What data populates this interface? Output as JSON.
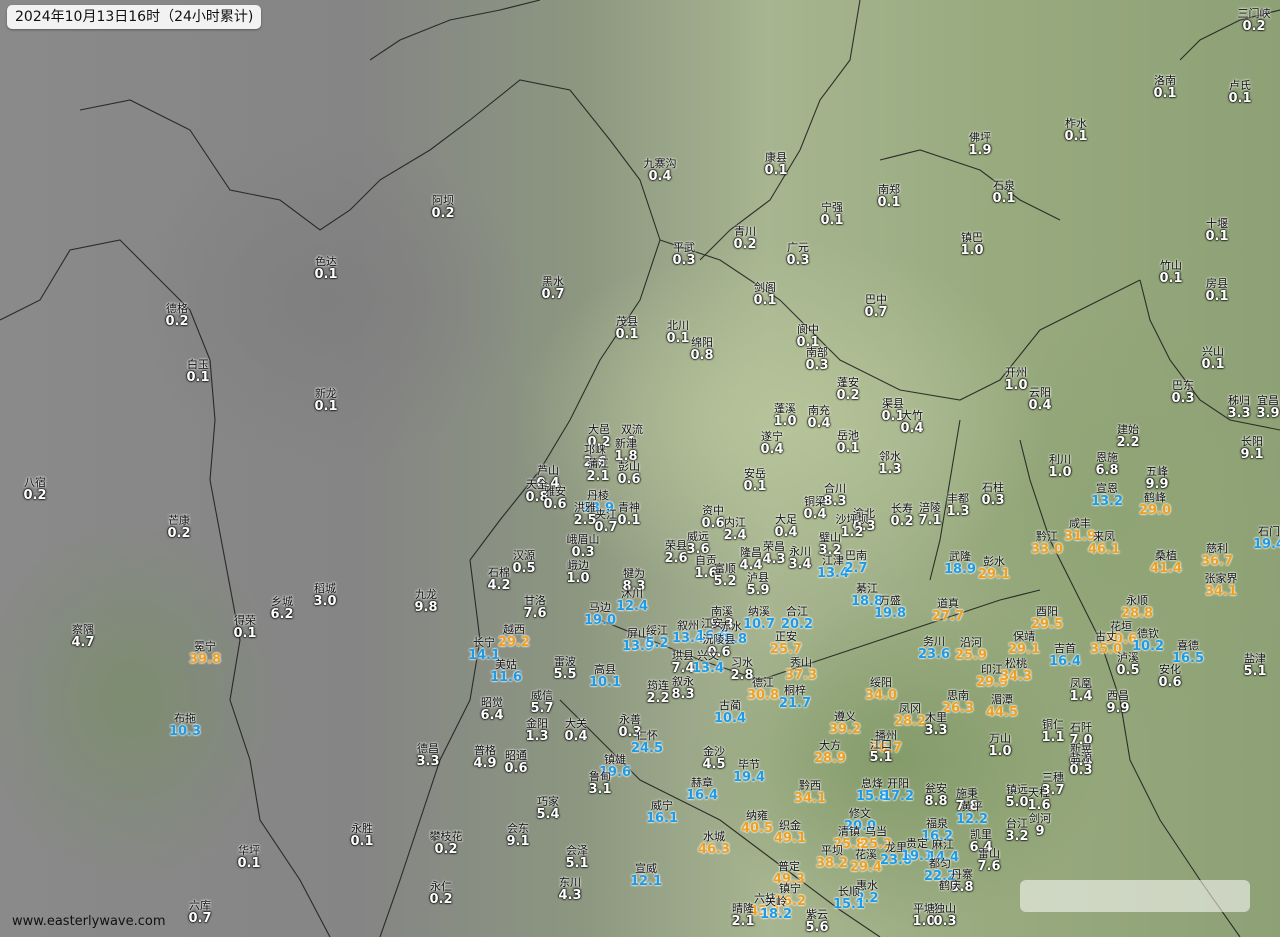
{
  "header": {
    "title": "2024年10月13日16时（24小时累计)"
  },
  "footer": {
    "credit": "www.easterlywave.com"
  },
  "legend_colors": {
    "low": "#ffffff",
    "moderate": "#1e9be6",
    "heavy": "#f0a020"
  },
  "stations": [
    {
      "name": "三门峡",
      "value": "0.2",
      "cls": "w"
    },
    {
      "name": "洛南",
      "value": "0.1",
      "cls": "w"
    },
    {
      "name": "卢氏",
      "value": "0.1",
      "cls": "w"
    },
    {
      "name": "柞水",
      "value": "0.1",
      "cls": "w"
    },
    {
      "name": "佛坪",
      "value": "1.9",
      "cls": "w"
    },
    {
      "name": "九寨沟",
      "value": "0.4",
      "cls": "w"
    },
    {
      "name": "康县",
      "value": "0.1",
      "cls": "w"
    },
    {
      "name": "南郑",
      "value": "0.1",
      "cls": "w"
    },
    {
      "name": "石泉",
      "value": "0.1",
      "cls": "w"
    },
    {
      "name": "阿坝",
      "value": "0.2",
      "cls": "w"
    },
    {
      "name": "宁强",
      "value": "0.1",
      "cls": "w"
    },
    {
      "name": "镇巴",
      "value": "1.0",
      "cls": "w"
    },
    {
      "name": "十堰",
      "value": "0.1",
      "cls": "w"
    },
    {
      "name": "青川",
      "value": "0.2",
      "cls": "w"
    },
    {
      "name": "平武",
      "value": "0.3",
      "cls": "w"
    },
    {
      "name": "广元",
      "value": "0.3",
      "cls": "w"
    },
    {
      "name": "色达",
      "value": "0.1",
      "cls": "w"
    },
    {
      "name": "黑水",
      "value": "0.7",
      "cls": "w"
    },
    {
      "name": "竹山",
      "value": "0.1",
      "cls": "w"
    },
    {
      "name": "房县",
      "value": "0.1",
      "cls": "w"
    },
    {
      "name": "剑阁",
      "value": "0.1",
      "cls": "w"
    },
    {
      "name": "巴中",
      "value": "0.7",
      "cls": "w"
    },
    {
      "name": "德格",
      "value": "0.2",
      "cls": "w"
    },
    {
      "name": "茂县",
      "value": "0.1",
      "cls": "w"
    },
    {
      "name": "北川",
      "value": "0.1",
      "cls": "w"
    },
    {
      "name": "阆中",
      "value": "0.1",
      "cls": "w"
    },
    {
      "name": "绵阳",
      "value": "0.8",
      "cls": "w"
    },
    {
      "name": "南部",
      "value": "0.3",
      "cls": "w"
    },
    {
      "name": "兴山",
      "value": "0.1",
      "cls": "w"
    },
    {
      "name": "白玉",
      "value": "0.1",
      "cls": "w"
    },
    {
      "name": "开州",
      "value": "1.0",
      "cls": "w"
    },
    {
      "name": "蓬安",
      "value": "0.2",
      "cls": "w"
    },
    {
      "name": "巴东",
      "value": "0.3",
      "cls": "w"
    },
    {
      "name": "新龙",
      "value": "0.1",
      "cls": "w"
    },
    {
      "name": "云阳",
      "value": "0.4",
      "cls": "w"
    },
    {
      "name": "秭归",
      "value": "3.3",
      "cls": "w"
    },
    {
      "name": "宜昌",
      "value": "3.9",
      "cls": "w"
    },
    {
      "name": "渠县",
      "value": "0.1",
      "cls": "w"
    },
    {
      "name": "大竹",
      "value": "0.4",
      "cls": "w"
    },
    {
      "name": "蓬溪",
      "value": "1.0",
      "cls": "w"
    },
    {
      "name": "南充",
      "value": "0.4",
      "cls": "w"
    },
    {
      "name": "大邑",
      "value": "0.2",
      "cls": "w"
    },
    {
      "name": "双流",
      "value": "1",
      "cls": "w"
    },
    {
      "name": "建始",
      "value": "2.2",
      "cls": "w"
    },
    {
      "name": "长阳",
      "value": "9.1",
      "cls": "w"
    },
    {
      "name": "新津",
      "value": "1.8",
      "cls": "w"
    },
    {
      "name": "遂宁",
      "value": "0.4",
      "cls": "w"
    },
    {
      "name": "岳池",
      "value": "0.1",
      "cls": "w"
    },
    {
      "name": "邛崃",
      "value": "2.6",
      "cls": "w"
    },
    {
      "name": "蒲江",
      "value": "2.1",
      "cls": "w"
    },
    {
      "name": "彭山",
      "value": "0.6",
      "cls": "w"
    },
    {
      "name": "邻水",
      "value": "1.3",
      "cls": "w"
    },
    {
      "name": "利川",
      "value": "1.0",
      "cls": "w"
    },
    {
      "name": "恩施",
      "value": "6.8",
      "cls": "w"
    },
    {
      "name": "五峰",
      "value": "9.9",
      "cls": "w"
    },
    {
      "name": "芦山",
      "value": "0.4",
      "cls": "w"
    },
    {
      "name": "安岳",
      "value": "0.1",
      "cls": "w"
    },
    {
      "name": "合川",
      "value": "8.3",
      "cls": "w"
    },
    {
      "name": "石柱",
      "value": "0.3",
      "cls": "w"
    },
    {
      "name": "八宿",
      "value": "0.2",
      "cls": "w"
    },
    {
      "name": "天全",
      "value": "0.8",
      "cls": "w"
    },
    {
      "name": "雅安",
      "value": "0.6",
      "cls": "w"
    },
    {
      "name": "丹棱",
      "value": "13.9",
      "cls": "blue"
    },
    {
      "name": "宣恩",
      "value": "13.2",
      "cls": "blue"
    },
    {
      "name": "鹤峰",
      "value": "29.0",
      "cls": "orange"
    },
    {
      "name": "洪雅",
      "value": "2.5",
      "cls": "w"
    },
    {
      "name": "夹江",
      "value": "0.7",
      "cls": "w"
    },
    {
      "name": "青神",
      "value": "0.1",
      "cls": "w"
    },
    {
      "name": "资中",
      "value": "0.6",
      "cls": "w"
    },
    {
      "name": "铜梁",
      "value": "0.4",
      "cls": "w"
    },
    {
      "name": "渝北",
      "value": "0.3",
      "cls": "w"
    },
    {
      "name": "长寿",
      "value": "0.2",
      "cls": "w"
    },
    {
      "name": "涪陵",
      "value": "7.1",
      "cls": "w"
    },
    {
      "name": "丰都",
      "value": "1.3",
      "cls": "w"
    },
    {
      "name": "芒康",
      "value": "0.2",
      "cls": "w"
    },
    {
      "name": "内江",
      "value": "2.4",
      "cls": "w"
    },
    {
      "name": "大足",
      "value": "0.4",
      "cls": "w"
    },
    {
      "name": "璧山",
      "value": "3.2",
      "cls": "w"
    },
    {
      "name": "沙坪坝",
      "value": "1.2",
      "cls": "w"
    },
    {
      "name": "黔江",
      "value": "33.0",
      "cls": "orange"
    },
    {
      "name": "咸丰",
      "value": "31.9",
      "cls": "orange"
    },
    {
      "name": "来凤",
      "value": "46.1",
      "cls": "orange"
    },
    {
      "name": "石门",
      "value": "19.4",
      "cls": "blue"
    },
    {
      "name": "峨眉山",
      "value": "0.3",
      "cls": "w"
    },
    {
      "name": "荣县",
      "value": "2.6",
      "cls": "w"
    },
    {
      "name": "威远",
      "value": "3.6",
      "cls": "w"
    },
    {
      "name": "自贡",
      "value": "1.6",
      "cls": "w"
    },
    {
      "name": "隆昌",
      "value": "4.4",
      "cls": "w"
    },
    {
      "name": "荣昌",
      "value": "4.3",
      "cls": "w"
    },
    {
      "name": "永川",
      "value": "3.4",
      "cls": "w"
    },
    {
      "name": "江津",
      "value": "13.4",
      "cls": "blue"
    },
    {
      "name": "巴南",
      "value": "2.7",
      "cls": "blue"
    },
    {
      "name": "武隆",
      "value": "18.9",
      "cls": "blue"
    },
    {
      "name": "彭水",
      "value": "29.1",
      "cls": "orange"
    },
    {
      "name": "桑植",
      "value": "41.4",
      "cls": "orange"
    },
    {
      "name": "慈利",
      "value": "36.7",
      "cls": "orange"
    },
    {
      "name": "汉源",
      "value": "0.5",
      "cls": "w"
    },
    {
      "name": "峨边",
      "value": "1.0",
      "cls": "w"
    },
    {
      "name": "富顺",
      "value": "5.2",
      "cls": "w"
    },
    {
      "name": "泸县",
      "value": "5.9",
      "cls": "w"
    },
    {
      "name": "张家界",
      "value": "34.1",
      "cls": "orange"
    },
    {
      "name": "稻城",
      "value": "3.0",
      "cls": "w"
    },
    {
      "name": "乡城",
      "value": "6.2",
      "cls": "w"
    },
    {
      "name": "九龙",
      "value": "9.8",
      "cls": "w"
    },
    {
      "name": "石棉",
      "value": "4.2",
      "cls": "w"
    },
    {
      "name": "甘洛",
      "value": "7.6",
      "cls": "w"
    },
    {
      "name": "犍为",
      "value": "8.3",
      "cls": "w"
    },
    {
      "name": "沐川",
      "value": "12.4",
      "cls": "blue"
    },
    {
      "name": "綦江",
      "value": "18.8",
      "cls": "blue"
    },
    {
      "name": "万盛",
      "value": "19.8",
      "cls": "blue"
    },
    {
      "name": "道真",
      "value": "27.7",
      "cls": "orange"
    },
    {
      "name": "酉阳",
      "value": "29.5",
      "cls": "orange"
    },
    {
      "name": "永顺",
      "value": "28.8",
      "cls": "orange"
    },
    {
      "name": "得荣",
      "value": "0.1",
      "cls": "w"
    },
    {
      "name": "马边",
      "value": "19.0",
      "cls": "blue"
    },
    {
      "name": "南溪",
      "value": "9.3",
      "cls": "w"
    },
    {
      "name": "纳溪",
      "value": "10.7",
      "cls": "blue"
    },
    {
      "name": "合江",
      "value": "20.2",
      "cls": "blue"
    },
    {
      "name": "察隅",
      "value": "4.7",
      "cls": "w"
    },
    {
      "name": "越西",
      "value": "29.2",
      "cls": "orange"
    },
    {
      "name": "屏山",
      "value": "13.9",
      "cls": "blue"
    },
    {
      "name": "绥江",
      "value": "5.2",
      "cls": "blue"
    },
    {
      "name": "叙州",
      "value": "13.4",
      "cls": "blue"
    },
    {
      "name": "江安",
      "value": "16.6",
      "cls": "blue"
    },
    {
      "name": "赤水",
      "value": "18.8",
      "cls": "blue"
    },
    {
      "name": "正安",
      "value": "25.7",
      "cls": "orange"
    },
    {
      "name": "务川",
      "value": "23.6",
      "cls": "blue"
    },
    {
      "name": "沿河",
      "value": "25.9",
      "cls": "orange"
    },
    {
      "name": "保靖",
      "value": "29.1",
      "cls": "orange"
    },
    {
      "name": "花垣",
      "value": "30.6",
      "cls": "orange"
    },
    {
      "name": "古丈",
      "value": "35.0",
      "cls": "orange"
    },
    {
      "name": "德钦",
      "value": "10.2",
      "cls": "blue"
    },
    {
      "name": "冕宁",
      "value": "39.8",
      "cls": "orange"
    },
    {
      "name": "长宁",
      "value": "14.1",
      "cls": "blue"
    },
    {
      "name": "沅陵县",
      "value": "0.6",
      "cls": "w"
    },
    {
      "name": "喜德",
      "value": "16.5",
      "cls": "blue"
    },
    {
      "name": "美姑",
      "value": "11.6",
      "cls": "blue"
    },
    {
      "name": "雷波",
      "value": "5.5",
      "cls": "w"
    },
    {
      "name": "高县",
      "value": "10.1",
      "cls": "blue"
    },
    {
      "name": "珙县",
      "value": "7.4",
      "cls": "w"
    },
    {
      "name": "兴文",
      "value": "13.4",
      "cls": "blue"
    },
    {
      "name": "习水",
      "value": "2.8",
      "cls": "w"
    },
    {
      "name": "秀山",
      "value": "37.3",
      "cls": "orange"
    },
    {
      "name": "吉首",
      "value": "16.4",
      "cls": "blue"
    },
    {
      "name": "泸溪",
      "value": "0.5",
      "cls": "w"
    },
    {
      "name": "安化",
      "value": "0.6",
      "cls": "w"
    },
    {
      "name": "盐津",
      "value": "5.1",
      "cls": "w"
    },
    {
      "name": "筠连",
      "value": "2.2",
      "cls": "w"
    },
    {
      "name": "叙永",
      "value": "8.3",
      "cls": "w"
    },
    {
      "name": "德江",
      "value": "30.8",
      "cls": "orange"
    },
    {
      "name": "印江",
      "value": "29.9",
      "cls": "orange"
    },
    {
      "name": "松桃",
      "value": "34.3",
      "cls": "orange"
    },
    {
      "name": "凤凰",
      "value": "1.4",
      "cls": "w"
    },
    {
      "name": "西昌",
      "value": "9.9",
      "cls": "w"
    },
    {
      "name": "昭觉",
      "value": "6.4",
      "cls": "w"
    },
    {
      "name": "威信",
      "value": "5.7",
      "cls": "w"
    },
    {
      "name": "古蔺",
      "value": "10.4",
      "cls": "blue"
    },
    {
      "name": "桐梓",
      "value": "21.7",
      "cls": "blue"
    },
    {
      "name": "绥阳",
      "value": "34.0",
      "cls": "orange"
    },
    {
      "name": "凤冈",
      "value": "28.2",
      "cls": "orange"
    },
    {
      "name": "思南",
      "value": "26.3",
      "cls": "orange"
    },
    {
      "name": "湄潭",
      "value": "44.5",
      "cls": "orange"
    },
    {
      "name": "木里",
      "value": "3.3",
      "cls": "w"
    },
    {
      "name": "布拖",
      "value": "10.3",
      "cls": "blue"
    },
    {
      "name": "金阳",
      "value": "1.3",
      "cls": "w"
    },
    {
      "name": "大关",
      "value": "0.4",
      "cls": "w"
    },
    {
      "name": "永善",
      "value": "0.3",
      "cls": "w"
    },
    {
      "name": "仁怀",
      "value": "24.5",
      "cls": "blue"
    },
    {
      "name": "遵义",
      "value": "39.2",
      "cls": "orange"
    },
    {
      "name": "播州",
      "value": "36.7",
      "cls": "orange"
    },
    {
      "name": "江口",
      "value": "5.1",
      "cls": "w"
    },
    {
      "name": "铜仁",
      "value": "1.1",
      "cls": "w"
    },
    {
      "name": "石阡",
      "value": "7.0",
      "cls": "w"
    },
    {
      "name": "万山",
      "value": "1.0",
      "cls": "w"
    },
    {
      "name": "新晃",
      "value": "0.4",
      "cls": "w"
    },
    {
      "name": "盐源",
      "value": "0.3",
      "cls": "w"
    },
    {
      "name": "德昌",
      "value": "3.3",
      "cls": "w"
    },
    {
      "name": "普格",
      "value": "4.9",
      "cls": "w"
    },
    {
      "name": "昭通",
      "value": "0.6",
      "cls": "w"
    },
    {
      "name": "镇雄",
      "value": "19.6",
      "cls": "blue"
    },
    {
      "name": "金沙",
      "value": "4.5",
      "cls": "w"
    },
    {
      "name": "毕节",
      "value": "19.4",
      "cls": "blue"
    },
    {
      "name": "大方",
      "value": "28.9",
      "cls": "orange"
    },
    {
      "name": "鲁甸",
      "value": "3.1",
      "cls": "w"
    },
    {
      "name": "赫章",
      "value": "16.4",
      "cls": "blue"
    },
    {
      "name": "黔西",
      "value": "34.1",
      "cls": "orange"
    },
    {
      "name": "息烽",
      "value": "15.8",
      "cls": "blue"
    },
    {
      "name": "开阳",
      "value": "17.2",
      "cls": "blue"
    },
    {
      "name": "瓮安",
      "value": "8.8",
      "cls": "w"
    },
    {
      "name": "施秉",
      "value": "7.8",
      "cls": "w"
    },
    {
      "name": "镇远",
      "value": "5.0",
      "cls": "w"
    },
    {
      "name": "天柱",
      "value": "1.6",
      "cls": "w"
    },
    {
      "name": "三穗",
      "value": "3.7",
      "cls": "w"
    },
    {
      "name": "黄平",
      "value": "12.2",
      "cls": "blue"
    },
    {
      "name": "巧家",
      "value": "5.4",
      "cls": "w"
    },
    {
      "name": "永胜",
      "value": "0.1",
      "cls": "w"
    },
    {
      "name": "攀枝花",
      "value": "0.2",
      "cls": "w"
    },
    {
      "name": "会东",
      "value": "9.1",
      "cls": "w"
    },
    {
      "name": "威宁",
      "value": "16.1",
      "cls": "blue"
    },
    {
      "name": "修文",
      "value": "20.0",
      "cls": "blue"
    },
    {
      "name": "纳雍",
      "value": "40.5",
      "cls": "orange"
    },
    {
      "name": "织金",
      "value": "49.1",
      "cls": "orange"
    },
    {
      "name": "清镇",
      "value": "25.8",
      "cls": "orange"
    },
    {
      "name": "乌当",
      "value": "25.2",
      "cls": "orange"
    },
    {
      "name": "福泉",
      "value": "16.2",
      "cls": "blue"
    },
    {
      "name": "台江",
      "value": "3.2",
      "cls": "w"
    },
    {
      "name": "剑河",
      "value": "9",
      "cls": "w"
    },
    {
      "name": "凯里",
      "value": "6.4",
      "cls": "w"
    },
    {
      "name": "水城",
      "value": "46.3",
      "cls": "orange"
    },
    {
      "name": "平坝",
      "value": "38.2",
      "cls": "orange"
    },
    {
      "name": "花溪",
      "value": "29.4",
      "cls": "orange"
    },
    {
      "name": "龙里",
      "value": "23.0",
      "cls": "blue"
    },
    {
      "name": "贵定",
      "value": "19.1",
      "cls": "blue"
    },
    {
      "name": "麻江",
      "value": "14.4",
      "cls": "blue"
    },
    {
      "name": "雷山",
      "value": "7.6",
      "cls": "w"
    },
    {
      "name": "华坪",
      "value": "0.1",
      "cls": "w"
    },
    {
      "name": "会泽",
      "value": "5.1",
      "cls": "w"
    },
    {
      "name": "普定",
      "value": "49.3",
      "cls": "orange"
    },
    {
      "name": "六枝",
      "value": "43.1",
      "cls": "orange"
    },
    {
      "name": "都匀",
      "value": "22.2",
      "cls": "blue"
    },
    {
      "name": "丹寨",
      "value": "5.8",
      "cls": "w"
    },
    {
      "name": "永仁",
      "value": "0.2",
      "cls": "w"
    },
    {
      "name": "东川",
      "value": "4.3",
      "cls": "w"
    },
    {
      "name": "宣威",
      "value": "12.1",
      "cls": "blue"
    },
    {
      "name": "镇宁",
      "value": "26.2",
      "cls": "orange"
    },
    {
      "name": "惠水",
      "value": "2.2",
      "cls": "blue"
    },
    {
      "name": "长顺",
      "value": "15.1",
      "cls": "blue"
    },
    {
      "name": "关岭",
      "value": "18.2",
      "cls": "blue"
    },
    {
      "name": "六库",
      "value": "0.7",
      "cls": "w"
    },
    {
      "name": "晴隆",
      "value": "2.1",
      "cls": "w"
    },
    {
      "name": "紫云",
      "value": "5.6",
      "cls": "w"
    },
    {
      "name": "平塘",
      "value": "1.0",
      "cls": "w"
    },
    {
      "name": "独山",
      "value": "0.3",
      "cls": "w"
    },
    {
      "name": "鹤庆",
      "value": "",
      "cls": "w"
    }
  ]
}
